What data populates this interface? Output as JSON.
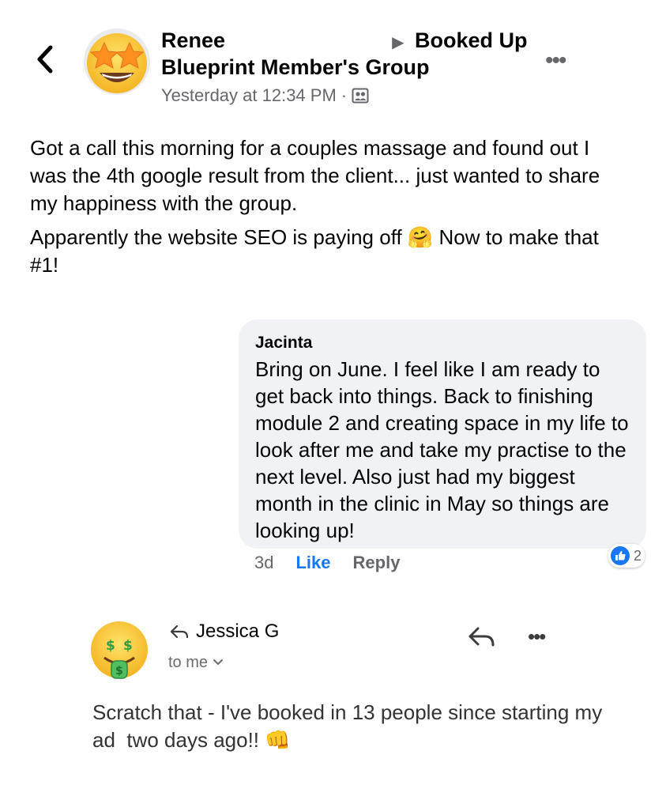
{
  "post": {
    "author": "Renee",
    "group_name_line1": "Booked Up",
    "group_name_line2": "Blueprint Member's Group",
    "timestamp": "Yesterday at 12:34 PM",
    "meta_separator": "·",
    "audience_icon": "group-members-icon",
    "avatar_icon": "star-struck-emoji-icon",
    "paragraph1": "Got a call this morning for a couples massage and found out I was the 4th google result from the client... just wanted to share my happiness with the group.",
    "paragraph2_before_emoji": "Apparently the website SEO is paying off",
    "paragraph2_emoji": "🤗",
    "paragraph2_after_emoji": "Now to make that #1!"
  },
  "comment": {
    "author": "Jacinta",
    "text": "Bring on June. I feel like I am ready to get back into things. Back to finishing module 2 and creating space in my life to look after me and take my practise to the next level. Also just had my biggest month in the clinic in May so things are looking up!",
    "age": "3d",
    "like_label": "Like",
    "reply_label": "Reply",
    "reaction_icon": "like-reaction-icon",
    "reaction_count": "2"
  },
  "email": {
    "sender": "Jessica G",
    "recipient_line": "to me",
    "avatar_icon": "money-mouth-emoji-icon",
    "body_text": "Scratch that - I've booked in 13 people since starting my ad  two days ago!!",
    "body_emoji": "👊"
  },
  "colors": {
    "link_blue": "#1877f2",
    "secondary_text": "#65676b",
    "bubble_bg": "#f0f2f5"
  }
}
